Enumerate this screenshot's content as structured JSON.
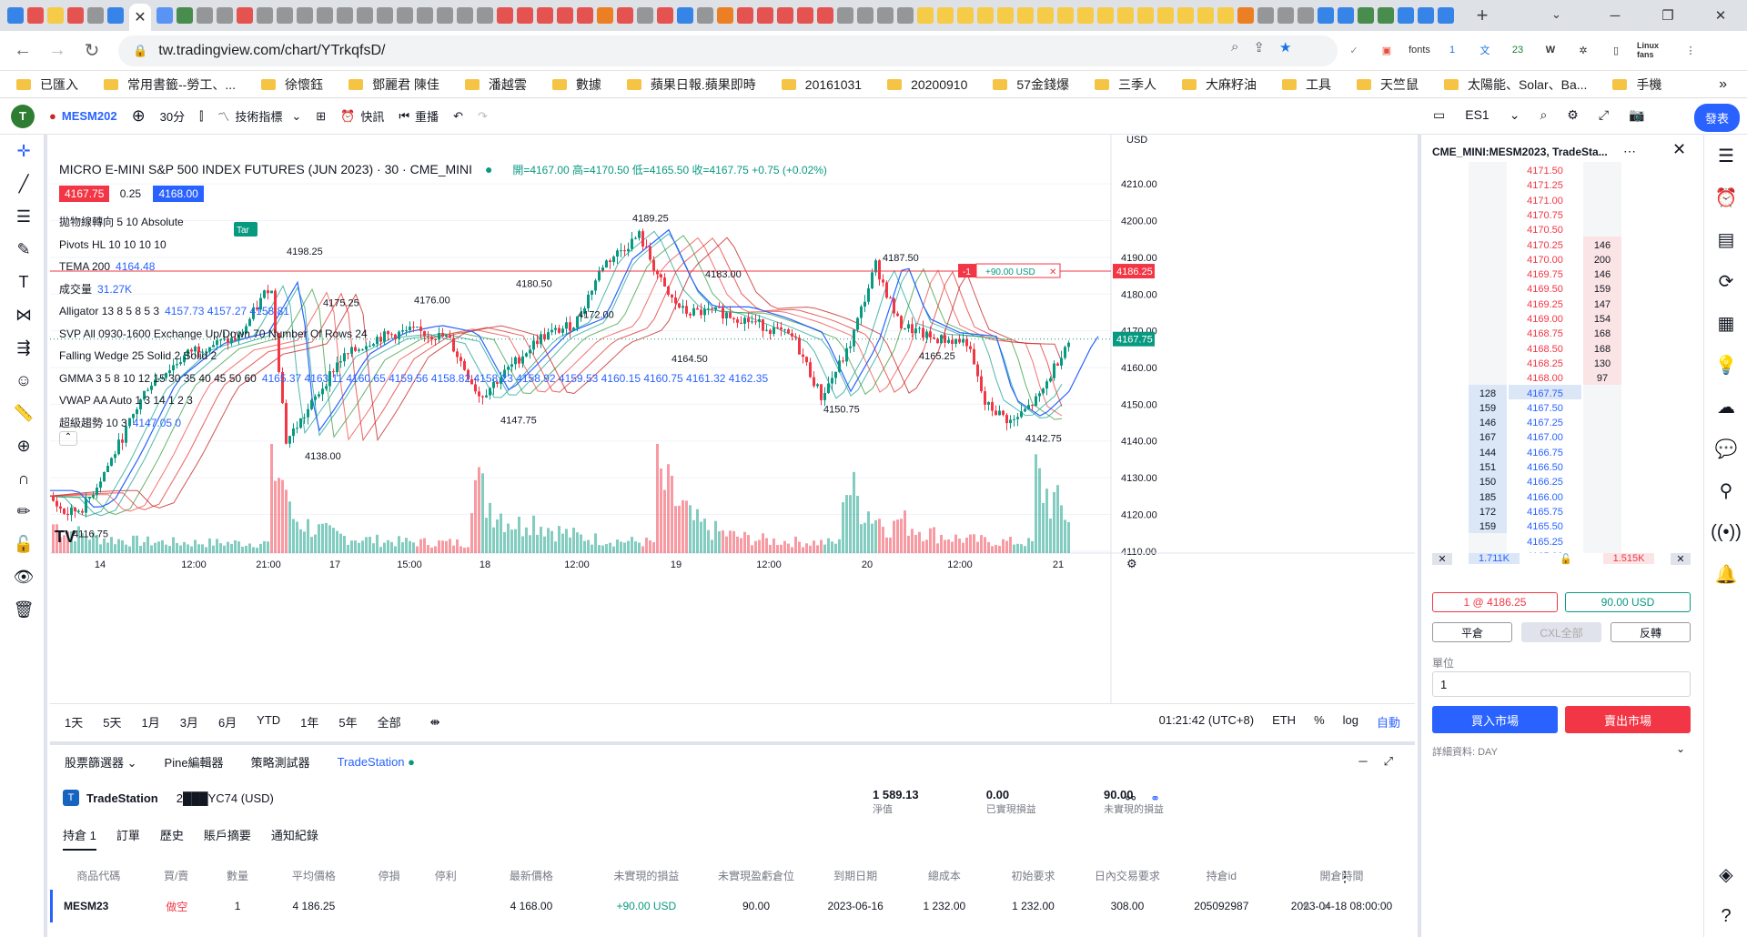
{
  "browser": {
    "tab_icons": [
      "blue",
      "red",
      "yellow",
      "red",
      "gray",
      "blue",
      "G",
      "green",
      "gray",
      "gray",
      "red",
      "gray",
      "gray",
      "gray",
      "gray",
      "gray",
      "gray",
      "gray",
      "gray",
      "gray",
      "gray",
      "gray",
      "gray",
      "red",
      "red",
      "red",
      "red",
      "red",
      "orange",
      "red",
      "gray",
      "red",
      "blue",
      "gray",
      "orange",
      "red",
      "red",
      "red",
      "red",
      "red",
      "gray",
      "gray",
      "gray",
      "gray",
      "yellow",
      "yellow",
      "yellow",
      "yellow",
      "yellow",
      "yellow",
      "yellow",
      "yellow",
      "yellow",
      "yellow",
      "yellow",
      "yellow",
      "yellow",
      "yellow",
      "yellow",
      "yellow",
      "orange",
      "gray",
      "gray",
      "gray",
      "blue",
      "blue",
      "green",
      "green",
      "blue",
      "blue",
      "blue"
    ],
    "active_tab_close": "✕",
    "new_tab": "+",
    "url": "tw.tradingview.com/chart/YTrkqfsD/",
    "ext_fonts": "fonts",
    "ext_badge_1": "1",
    "ext_badge_23": "23",
    "ext_linux": "Linux fans",
    "bookmarks": [
      "已匯入",
      "常用書籤--勞工、...",
      "徐懷鈺",
      "鄧麗君 陳佳",
      "潘越雲",
      "數據",
      "蘋果日報.蘋果即時",
      "20161031",
      "20200910",
      "57金錢爆",
      "三季人",
      "大麻籽油",
      "工具",
      "天竺鼠",
      "太陽能、Solar、Ba...",
      "手機"
    ]
  },
  "toolbar": {
    "avatar": "T",
    "symbol": "MESM202",
    "interval": "30分",
    "indicators": "技術指標",
    "alert": "快訊",
    "replay": "重播",
    "right_symbol": "ES1",
    "publish": "發表"
  },
  "chart": {
    "title": "MICRO E-MINI S&P 500 INDEX FUTURES (JUN 2023) · 30 · CME_MINI",
    "ohlc": "開=4167.00 高=4170.50 低=4165.50 收=4167.75 +0.75 (+0.02%)",
    "bid": "4167.75",
    "spread": "0.25",
    "ask": "4168.00",
    "currency": "USD",
    "legend": [
      {
        "name": "拋物線轉向 5 10 Absolute",
        "val": ""
      },
      {
        "name": "Pivots HL 10 10 10 10",
        "val": ""
      },
      {
        "name": "TEMA 200",
        "val": "4164.48"
      },
      {
        "name": "成交量",
        "val": "31.27K"
      },
      {
        "name": "Alligator 13 8 5 8 5 3",
        "val": "4157.73  4157.27  4158.81"
      },
      {
        "name": "SVP All 0930-1600 Exchange Up/Down 70 Number Of Rows 24",
        "val": ""
      },
      {
        "name": "Falling Wedge 25 Solid 2 Solid 2",
        "val": ""
      },
      {
        "name": "GMMA 3 5 8 10 12 15 30 35 40 45 50 60",
        "val": "4165.37  4163.11  4160.65  4159.56  4158.82  4158.23  4158.92  4159.53  4160.15  4160.75  4161.32  4162.35"
      },
      {
        "name": "VWAP AA Auto 1 3 14 1 2 3",
        "val": ""
      },
      {
        "name": "超級趨勢 10 3",
        "val": "4147.05  0"
      }
    ],
    "price_labels": [
      "4210.00",
      "4200.00",
      "4190.00",
      "4180.00",
      "4170.00",
      "4160.00",
      "4150.00",
      "4140.00",
      "4130.00",
      "4120.00",
      "4110.00"
    ],
    "time_labels": [
      "14",
      "12:00",
      "21:00",
      "17",
      "15:00",
      "18",
      "12:00",
      "19",
      "12:00",
      "20",
      "12:00",
      "21"
    ],
    "annotations": [
      "4189.25",
      "4198.25",
      "4183.00",
      "4187.50",
      "4180.50",
      "4176.00",
      "4172.00",
      "4164.50",
      "4165.25",
      "4150.75",
      "4147.75",
      "4142.75",
      "4138.00",
      "4116.75",
      "4175.25"
    ],
    "current_price": "4167.75",
    "position_price": "4186.25",
    "position_qty": "-1",
    "position_pnl": "+90.00 USD",
    "position_close": "✕",
    "tag": "Tar",
    "chart_data": {
      "type": "candlestick",
      "xlabel": "",
      "ylabel": "",
      "ylim": [
        4105,
        4215
      ],
      "categories": [
        "14",
        "12:00",
        "21:00",
        "17",
        "15:00",
        "18",
        "12:00",
        "19",
        "12:00",
        "20",
        "12:00",
        "21"
      ],
      "series": [
        {
          "name": "",
          "values": [
            4120,
            4125,
            4135,
            4150,
            4160,
            4165,
            4170,
            4185,
            4140,
            4148,
            4165,
            4168,
            4172,
            4170,
            4165,
            4150,
            4175,
            4192,
            4180,
            4175,
            4170,
            4178,
            4160,
            4155,
            4185,
            4172,
            4170,
            4165,
            4150,
            4160,
            4167.75
          ]
        }
      ]
    }
  },
  "timebar": {
    "ranges": [
      "1天",
      "5天",
      "1月",
      "3月",
      "6月",
      "YTD",
      "1年",
      "5年",
      "全部"
    ],
    "clock": "01:21:42 (UTC+8)",
    "session": "ETH",
    "percent": "%",
    "log": "log",
    "auto": "自動"
  },
  "bottom": {
    "tabs": [
      "股票篩選器",
      "Pine編輯器",
      "策略測試器",
      "TradeStation"
    ],
    "broker": "TradeStation",
    "account": "2███YC74 (USD)",
    "equity": "1 589.13",
    "equity_label": "淨值",
    "realized": "0.00",
    "realized_label": "已實現損益",
    "unrealized": "90.00",
    "unrealized_label": "未實現的損益",
    "subtabs": [
      "持倉 1",
      "訂單",
      "歷史",
      "賬戶摘要",
      "通知紀錄"
    ],
    "columns": [
      "商品代碼",
      "買/賣",
      "數量",
      "平均價格",
      "停損",
      "停利",
      "最新價格",
      "未實現的損益",
      "未實現盈虧倉位",
      "到期日期",
      "總成本",
      "初始要求",
      "日內交易要求",
      "持倉id",
      "開倉時間"
    ],
    "row": [
      "MESM23",
      "做空",
      "1",
      "4 186.25",
      "",
      "",
      "4 168.00",
      "+90.00 USD",
      "90.00",
      "2023-06-16",
      "1 232.00",
      "1 232.00",
      "308.00",
      "205092987",
      "2023-04-18 08:00:00"
    ]
  },
  "dom": {
    "title": "CME_MINI:MESM2023, TradeSta...",
    "prices": [
      "4171.50",
      "4171.25",
      "4171.00",
      "4170.75",
      "4170.50",
      "4170.25",
      "4170.00",
      "4169.75",
      "4169.50",
      "4169.25",
      "4169.00",
      "4168.75",
      "4168.50",
      "4168.25",
      "4168.00",
      "4167.75",
      "4167.50",
      "4167.25",
      "4167.00",
      "4166.75",
      "4166.50",
      "4166.25",
      "4166.00",
      "4165.75",
      "4165.50",
      "4165.25",
      "4165.00"
    ],
    "asks": [
      "",
      "",
      "",
      "",
      "",
      "146",
      "200",
      "146",
      "159",
      "147",
      "154",
      "168",
      "168",
      "130",
      "97",
      "",
      "",
      "",
      "",
      "",
      "",
      "",
      "",
      "",
      "",
      "",
      ""
    ],
    "bids": [
      "",
      "",
      "",
      "",
      "",
      "",
      "",
      "",
      "",
      "",
      "",
      "",
      "",
      "",
      "",
      "128",
      "159",
      "146",
      "167",
      "144",
      "151",
      "150",
      "185",
      "172",
      "159",
      "",
      ""
    ],
    "bid_total": "1.711K",
    "ask_total": "1.515K",
    "pos_label": "1 @ 4186.25",
    "pnl_label": "90.00 USD",
    "flatten": "平倉",
    "cxl_all": "CXL全部",
    "reverse": "反轉",
    "units_label": "單位",
    "units": "1",
    "buy_market": "買入市場",
    "sell_market": "賣出市場",
    "details": "詳細資料: DAY"
  },
  "colors": {
    "up": "#089981",
    "down": "#f23645",
    "accent": "#2962ff"
  }
}
